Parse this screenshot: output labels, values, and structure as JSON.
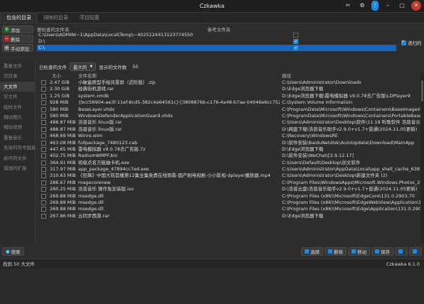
{
  "window": {
    "title": "Czkawka"
  },
  "tabs": [
    "包含的目录",
    "排除的目录",
    "项目配置"
  ],
  "include_buttons": [
    {
      "label": "添加",
      "color": "#2e7d32"
    },
    {
      "label": "删除",
      "color": "#c62828"
    },
    {
      "label": "手动添加",
      "color": "#777777"
    }
  ],
  "dirs": {
    "header_path": "要检查的文件夹",
    "header_ref": "参考文件夹",
    "items": [
      {
        "path": "C:\\Users\\ADMINI~1\\AppData\\Local\\Temp\\~4025124413123774550",
        "ref": false
      },
      {
        "path": "D:\\",
        "ref": true
      },
      {
        "path": "C:\\",
        "ref": true,
        "selected": true
      }
    ],
    "referenced_label": "递归的"
  },
  "sidebar": [
    "重复文件",
    "空目录",
    "大文件",
    "空文件",
    "临时文件",
    "相似图片",
    "相似视频",
    "重复音乐",
    "无效的符号链接",
    "损坏的文件",
    "错误的扩展"
  ],
  "sidebar_active": 2,
  "toolbar": {
    "label": "已检查的文件",
    "mode": "最大的",
    "count_label": "显示的文件数",
    "count": "50"
  },
  "table": {
    "headers": [
      "大小",
      "文件名称",
      "路径"
    ],
    "rows": [
      [
        "2.47 GiB",
        "小破盒原型手绘风景屏（近阶版）.zip",
        "C:\\Users\\Administrator\\Downloads"
      ],
      [
        "2.30 GiB",
        "经典街机游戏.rar",
        "D:\\Edge浏览器下载"
      ],
      [
        "1.25 GiB",
        "system.vmdk",
        "D:\\Edge浏览器下载\\雷电模拟器 v9.0.78去广告版\\LDPlayer9"
      ],
      [
        "928 MiB",
        "{bcc56904-ae3f-11ef-8cd5-382c4a64561c}{3808876b-c176-4e48-b7ae-04046e6cc752}",
        "C:\\System Volume Information"
      ],
      [
        "580 MiB",
        "BaseLayer.vhdx",
        "C:\\ProgramData\\Microsoft\\Windows\\Containers\\BaseImages\\"
      ],
      [
        "580 MiB",
        "WindowsDefenderApplicationGuard.vhdx",
        "C:\\ProgramData\\Microsoft\\Windows\\Containers\\PortableBase"
      ],
      [
        "488.87 MiB",
        "浩普音乐 linux版.rar",
        "C:\\Users\\Administrator\\Desktop\\软件\\11.19 听歌软件 浩普音示"
      ],
      [
        "488.87 MiB",
        "浩普音乐 linux版.rar",
        "D:\\网盘下载\\浩普音乐助手v2.9.0+v1.7+普通(2024.11.05更新)"
      ],
      [
        "468.69 MiB",
        "Winre.wim",
        "C:\\Recovery\\WindowsRE"
      ],
      [
        "463.08 MiB",
        "fullpackage_7480123.cab",
        "D:\\软件安装\\BaiduNetdisk\\AutoUpdate\\Download\\MainApp"
      ],
      [
        "447.65 MiB",
        "雷电模拟器 v9.0.78去广告版.7z",
        "D:\\Edge浏览器下载"
      ],
      [
        "402.75 MiB",
        "RadiumWMPF.bin",
        "D:\\软件安装\\WeChat\\[3.9.12.17]"
      ],
      [
        "364.91 MiB",
        "班级点名万能抽卡机.exe",
        "C:\\Users\\Default\\Desktop\\创文软件"
      ],
      [
        "317.97 MiB",
        "app_package_47894cc7ed.exe",
        "C:\\Users\\Administrator\\AppData\\Local\\app_shell_cache_6383"
      ],
      [
        "310.63 MiB",
        "《狂飙》中国大陆首播第12集全集免费在线观看-国产剧电视剧-小小影视-dplayer播放器.mp4",
        "C:\\Users\\Administrator\\Desktop\\新建文件夹 (2)"
      ],
      [
        "286.67 MiB",
        "magecorenew",
        "C:\\Program Files\\WindowsApps\\Microsoft.Windows.Photos_20"
      ],
      [
        "280.25 MiB",
        "浩普音乐 操作免安装版.iso",
        "D:\\浩普云盘\\浩普音乐助手v2.9.0+v1.7+普通(2024.11.05更新)"
      ],
      [
        "269.88 MiB",
        "msedge.dll",
        "C:\\Program Files (x86)\\Microsoft\\EdgeCore\\131.0.2903.70"
      ],
      [
        "269.88 MiB",
        "msedge.dll",
        "C:\\Program Files (x86)\\Microsoft\\EdgeWebView\\Application\\131.0"
      ],
      [
        "269.88 MiB",
        "msedge.dll",
        "C:\\Program Files (x86)\\Microsoft\\Edge\\Application\\131.0.2903."
      ],
      [
        "267.86 MiB",
        "云同步西游.rar",
        "D:\\Edge浏览器下载"
      ]
    ]
  },
  "bottom": {
    "search": "搜索",
    "actions": [
      "选择",
      "删除",
      "移动",
      "保存",
      "",
      ""
    ]
  },
  "status": {
    "left": "找到 50 大文件",
    "right": "Czkawka 6.1.0"
  }
}
